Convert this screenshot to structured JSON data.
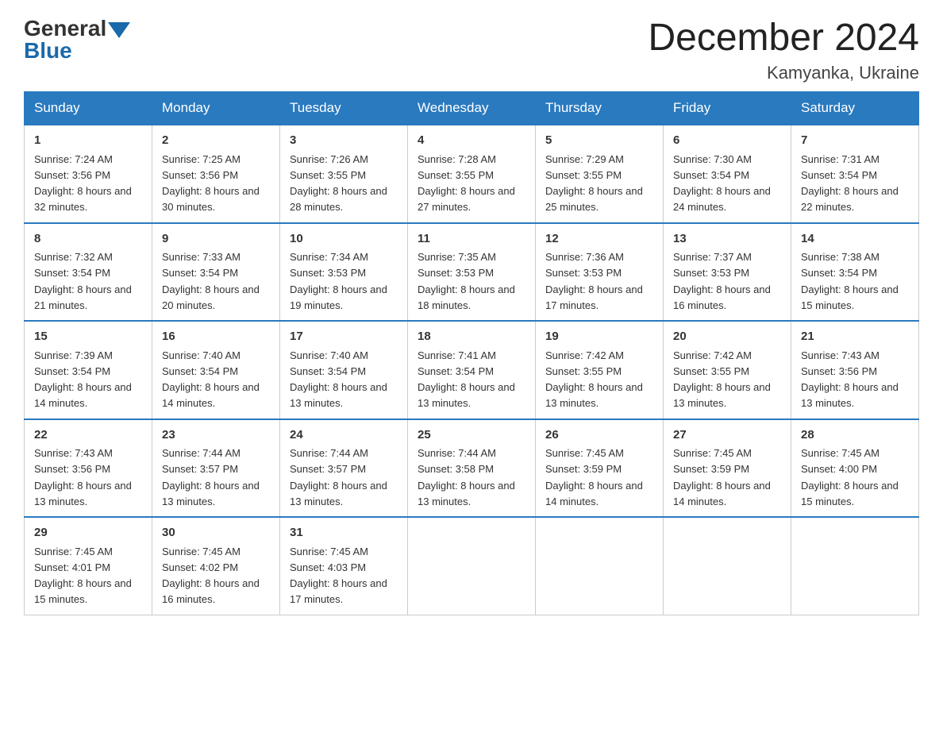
{
  "header": {
    "logo_general": "General",
    "logo_blue": "Blue",
    "month_title": "December 2024",
    "location": "Kamyanka, Ukraine"
  },
  "weekdays": [
    "Sunday",
    "Monday",
    "Tuesday",
    "Wednesday",
    "Thursday",
    "Friday",
    "Saturday"
  ],
  "weeks": [
    [
      {
        "day": "1",
        "sunrise": "7:24 AM",
        "sunset": "3:56 PM",
        "daylight": "8 hours and 32 minutes."
      },
      {
        "day": "2",
        "sunrise": "7:25 AM",
        "sunset": "3:56 PM",
        "daylight": "8 hours and 30 minutes."
      },
      {
        "day": "3",
        "sunrise": "7:26 AM",
        "sunset": "3:55 PM",
        "daylight": "8 hours and 28 minutes."
      },
      {
        "day": "4",
        "sunrise": "7:28 AM",
        "sunset": "3:55 PM",
        "daylight": "8 hours and 27 minutes."
      },
      {
        "day": "5",
        "sunrise": "7:29 AM",
        "sunset": "3:55 PM",
        "daylight": "8 hours and 25 minutes."
      },
      {
        "day": "6",
        "sunrise": "7:30 AM",
        "sunset": "3:54 PM",
        "daylight": "8 hours and 24 minutes."
      },
      {
        "day": "7",
        "sunrise": "7:31 AM",
        "sunset": "3:54 PM",
        "daylight": "8 hours and 22 minutes."
      }
    ],
    [
      {
        "day": "8",
        "sunrise": "7:32 AM",
        "sunset": "3:54 PM",
        "daylight": "8 hours and 21 minutes."
      },
      {
        "day": "9",
        "sunrise": "7:33 AM",
        "sunset": "3:54 PM",
        "daylight": "8 hours and 20 minutes."
      },
      {
        "day": "10",
        "sunrise": "7:34 AM",
        "sunset": "3:53 PM",
        "daylight": "8 hours and 19 minutes."
      },
      {
        "day": "11",
        "sunrise": "7:35 AM",
        "sunset": "3:53 PM",
        "daylight": "8 hours and 18 minutes."
      },
      {
        "day": "12",
        "sunrise": "7:36 AM",
        "sunset": "3:53 PM",
        "daylight": "8 hours and 17 minutes."
      },
      {
        "day": "13",
        "sunrise": "7:37 AM",
        "sunset": "3:53 PM",
        "daylight": "8 hours and 16 minutes."
      },
      {
        "day": "14",
        "sunrise": "7:38 AM",
        "sunset": "3:54 PM",
        "daylight": "8 hours and 15 minutes."
      }
    ],
    [
      {
        "day": "15",
        "sunrise": "7:39 AM",
        "sunset": "3:54 PM",
        "daylight": "8 hours and 14 minutes."
      },
      {
        "day": "16",
        "sunrise": "7:40 AM",
        "sunset": "3:54 PM",
        "daylight": "8 hours and 14 minutes."
      },
      {
        "day": "17",
        "sunrise": "7:40 AM",
        "sunset": "3:54 PM",
        "daylight": "8 hours and 13 minutes."
      },
      {
        "day": "18",
        "sunrise": "7:41 AM",
        "sunset": "3:54 PM",
        "daylight": "8 hours and 13 minutes."
      },
      {
        "day": "19",
        "sunrise": "7:42 AM",
        "sunset": "3:55 PM",
        "daylight": "8 hours and 13 minutes."
      },
      {
        "day": "20",
        "sunrise": "7:42 AM",
        "sunset": "3:55 PM",
        "daylight": "8 hours and 13 minutes."
      },
      {
        "day": "21",
        "sunrise": "7:43 AM",
        "sunset": "3:56 PM",
        "daylight": "8 hours and 13 minutes."
      }
    ],
    [
      {
        "day": "22",
        "sunrise": "7:43 AM",
        "sunset": "3:56 PM",
        "daylight": "8 hours and 13 minutes."
      },
      {
        "day": "23",
        "sunrise": "7:44 AM",
        "sunset": "3:57 PM",
        "daylight": "8 hours and 13 minutes."
      },
      {
        "day": "24",
        "sunrise": "7:44 AM",
        "sunset": "3:57 PM",
        "daylight": "8 hours and 13 minutes."
      },
      {
        "day": "25",
        "sunrise": "7:44 AM",
        "sunset": "3:58 PM",
        "daylight": "8 hours and 13 minutes."
      },
      {
        "day": "26",
        "sunrise": "7:45 AM",
        "sunset": "3:59 PM",
        "daylight": "8 hours and 14 minutes."
      },
      {
        "day": "27",
        "sunrise": "7:45 AM",
        "sunset": "3:59 PM",
        "daylight": "8 hours and 14 minutes."
      },
      {
        "day": "28",
        "sunrise": "7:45 AM",
        "sunset": "4:00 PM",
        "daylight": "8 hours and 15 minutes."
      }
    ],
    [
      {
        "day": "29",
        "sunrise": "7:45 AM",
        "sunset": "4:01 PM",
        "daylight": "8 hours and 15 minutes."
      },
      {
        "day": "30",
        "sunrise": "7:45 AM",
        "sunset": "4:02 PM",
        "daylight": "8 hours and 16 minutes."
      },
      {
        "day": "31",
        "sunrise": "7:45 AM",
        "sunset": "4:03 PM",
        "daylight": "8 hours and 17 minutes."
      },
      null,
      null,
      null,
      null
    ]
  ]
}
